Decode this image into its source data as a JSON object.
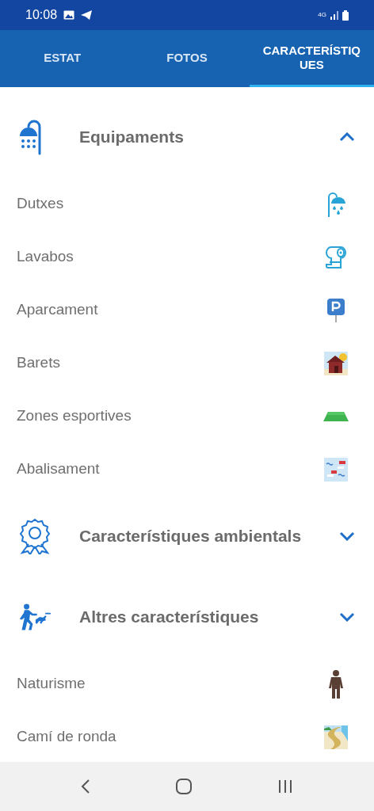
{
  "status_bar": {
    "time": "10:08",
    "network": "4G"
  },
  "tabs": [
    {
      "label": "ESTAT",
      "selected": false
    },
    {
      "label": "FOTOS",
      "selected": false
    },
    {
      "label": "CARACTERÍSTIQUES",
      "selected": true
    }
  ],
  "sections": [
    {
      "title": "Equipaments",
      "expanded": true,
      "items": [
        {
          "label": "Dutxes"
        },
        {
          "label": "Lavabos"
        },
        {
          "label": "Aparcament"
        },
        {
          "label": "Barets"
        },
        {
          "label": "Zones esportives"
        },
        {
          "label": "Abalisament"
        }
      ]
    },
    {
      "title": "Característiques ambientals",
      "expanded": false
    },
    {
      "title": "Altres característiques",
      "expanded": false,
      "items": [
        {
          "label": "Naturisme"
        },
        {
          "label": "Camí de ronda"
        }
      ]
    }
  ]
}
